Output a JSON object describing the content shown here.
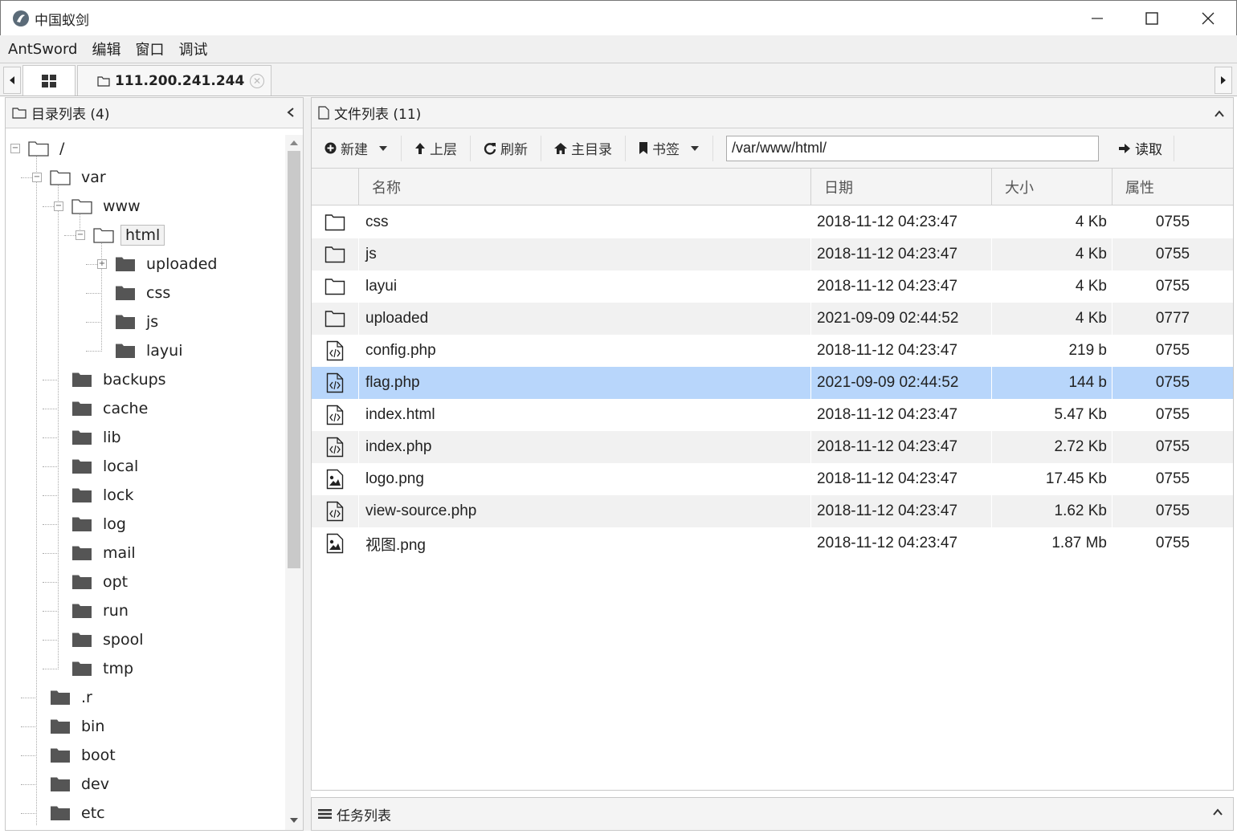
{
  "window": {
    "title": "中国蚁剑",
    "minimize_icon": "minimize-icon",
    "maximize_icon": "maximize-icon",
    "close_icon": "close-icon"
  },
  "menu": [
    "AntSword",
    "编辑",
    "窗口",
    "调试"
  ],
  "tabs": {
    "host_label": "111.200.241.244"
  },
  "left_panel": {
    "title": "目录列表 (4)",
    "tree": [
      {
        "label": "/",
        "depth": 0,
        "type": "open"
      },
      {
        "label": "var",
        "depth": 1,
        "type": "open"
      },
      {
        "label": "www",
        "depth": 2,
        "type": "open"
      },
      {
        "label": "html",
        "depth": 3,
        "type": "open",
        "selected": true
      },
      {
        "label": "uploaded",
        "depth": 4,
        "type": "closed",
        "expandable": true
      },
      {
        "label": "css",
        "depth": 4,
        "type": "closed"
      },
      {
        "label": "js",
        "depth": 4,
        "type": "closed"
      },
      {
        "label": "layui",
        "depth": 4,
        "type": "closed"
      },
      {
        "label": "backups",
        "depth": 2,
        "type": "closed"
      },
      {
        "label": "cache",
        "depth": 2,
        "type": "closed"
      },
      {
        "label": "lib",
        "depth": 2,
        "type": "closed"
      },
      {
        "label": "local",
        "depth": 2,
        "type": "closed"
      },
      {
        "label": "lock",
        "depth": 2,
        "type": "closed"
      },
      {
        "label": "log",
        "depth": 2,
        "type": "closed"
      },
      {
        "label": "mail",
        "depth": 2,
        "type": "closed"
      },
      {
        "label": "opt",
        "depth": 2,
        "type": "closed"
      },
      {
        "label": "run",
        "depth": 2,
        "type": "closed"
      },
      {
        "label": "spool",
        "depth": 2,
        "type": "closed"
      },
      {
        "label": "tmp",
        "depth": 2,
        "type": "closed"
      },
      {
        "label": ".r",
        "depth": 1,
        "type": "closed"
      },
      {
        "label": "bin",
        "depth": 1,
        "type": "closed"
      },
      {
        "label": "boot",
        "depth": 1,
        "type": "closed"
      },
      {
        "label": "dev",
        "depth": 1,
        "type": "closed"
      },
      {
        "label": "etc",
        "depth": 1,
        "type": "closed"
      }
    ]
  },
  "right_panel": {
    "title": "文件列表 (11)",
    "toolbar": {
      "new_label": "新建",
      "up_label": "上层",
      "refresh_label": "刷新",
      "home_label": "主目录",
      "bookmark_label": "书签",
      "path_value": "/var/www/html/",
      "read_label": "读取"
    },
    "columns": {
      "name": "名称",
      "date": "日期",
      "size": "大小",
      "attr": "属性"
    },
    "files": [
      {
        "icon": "folder",
        "name": "css",
        "date": "2018-11-12 04:23:47",
        "size": "4 Kb",
        "attr": "0755"
      },
      {
        "icon": "folder",
        "name": "js",
        "date": "2018-11-12 04:23:47",
        "size": "4 Kb",
        "attr": "0755"
      },
      {
        "icon": "folder",
        "name": "layui",
        "date": "2018-11-12 04:23:47",
        "size": "4 Kb",
        "attr": "0755"
      },
      {
        "icon": "folder",
        "name": "uploaded",
        "date": "2021-09-09 02:44:52",
        "size": "4 Kb",
        "attr": "0777"
      },
      {
        "icon": "code",
        "name": "config.php",
        "date": "2018-11-12 04:23:47",
        "size": "219 b",
        "attr": "0755"
      },
      {
        "icon": "code",
        "name": "flag.php",
        "date": "2021-09-09 02:44:52",
        "size": "144 b",
        "attr": "0755",
        "selected": true
      },
      {
        "icon": "code",
        "name": "index.html",
        "date": "2018-11-12 04:23:47",
        "size": "5.47 Kb",
        "attr": "0755"
      },
      {
        "icon": "code",
        "name": "index.php",
        "date": "2018-11-12 04:23:47",
        "size": "2.72 Kb",
        "attr": "0755"
      },
      {
        "icon": "image",
        "name": "logo.png",
        "date": "2018-11-12 04:23:47",
        "size": "17.45 Kb",
        "attr": "0755"
      },
      {
        "icon": "code",
        "name": "view-source.php",
        "date": "2018-11-12 04:23:47",
        "size": "1.62 Kb",
        "attr": "0755"
      },
      {
        "icon": "image",
        "name": "视图.png",
        "date": "2018-11-12 04:23:47",
        "size": "1.87 Mb",
        "attr": "0755"
      }
    ]
  },
  "task_panel": {
    "title": "任务列表"
  }
}
